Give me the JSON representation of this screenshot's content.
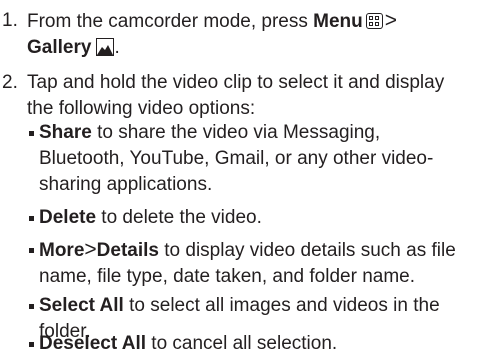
{
  "step1": {
    "number": "1.",
    "text_before": "From the camcorder mode, press ",
    "menu_label": "Menu",
    "separator": ">",
    "gallery_label": "Gallery",
    "text_after": "."
  },
  "step2": {
    "number": "2.",
    "line1": "Tap and hold the video clip to select it and display",
    "line2": "the following video options:"
  },
  "options": [
    {
      "bold": "Share",
      "lines": [
        " to share the video via Messaging,",
        "Bluetooth, YouTube, Gmail, or any other video-",
        "sharing applications."
      ]
    },
    {
      "bold": "Delete",
      "lines": [
        " to delete the video."
      ]
    },
    {
      "bold": "More",
      "separator": ">",
      "bold2": "Details",
      "lines": [
        " to display video details such as file",
        "name, file type, date taken, and folder name."
      ]
    },
    {
      "bold": "Select All",
      "lines": [
        " to select all images and videos in the",
        "folder."
      ]
    },
    {
      "bold": "Deselect All",
      "lines": [
        " to cancel all selection."
      ]
    }
  ],
  "icons": {
    "menu": "menu-grid-icon",
    "gallery": "gallery-picture-icon"
  }
}
